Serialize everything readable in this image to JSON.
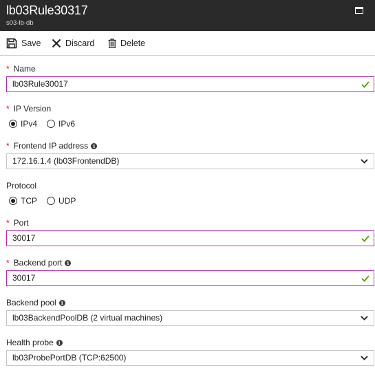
{
  "blade": {
    "title": "lb03Rule30317",
    "subtitle": "s03-lb-db"
  },
  "toolbar": {
    "save_label": "Save",
    "discard_label": "Discard",
    "delete_label": "Delete"
  },
  "form": {
    "name": {
      "label": "Name",
      "required": true,
      "value": "lb03Rule30017"
    },
    "ip_version": {
      "label": "IP Version",
      "required": true,
      "options": [
        "IPv4",
        "IPv6"
      ],
      "selected": "IPv4"
    },
    "frontend_ip": {
      "label": "Frontend IP address",
      "required": true,
      "value": "172.16.1.4 (lb03FrontendDB)"
    },
    "protocol": {
      "label": "Protocol",
      "required": false,
      "options": [
        "TCP",
        "UDP"
      ],
      "selected": "TCP"
    },
    "port": {
      "label": "Port",
      "required": true,
      "value": "30017"
    },
    "backend_port": {
      "label": "Backend port",
      "required": true,
      "value": "30017"
    },
    "backend_pool": {
      "label": "Backend pool",
      "required": false,
      "value": "lb03BackendPoolDB (2 virtual machines)"
    },
    "health_probe": {
      "label": "Health probe",
      "required": false,
      "value": "lb03ProbePortDB (TCP:62500)"
    }
  },
  "colors": {
    "title_bar": "#2a2a2a",
    "required_star": "#e00b1c",
    "valid_border": "#b02eb0",
    "valid_check": "#57a300"
  }
}
